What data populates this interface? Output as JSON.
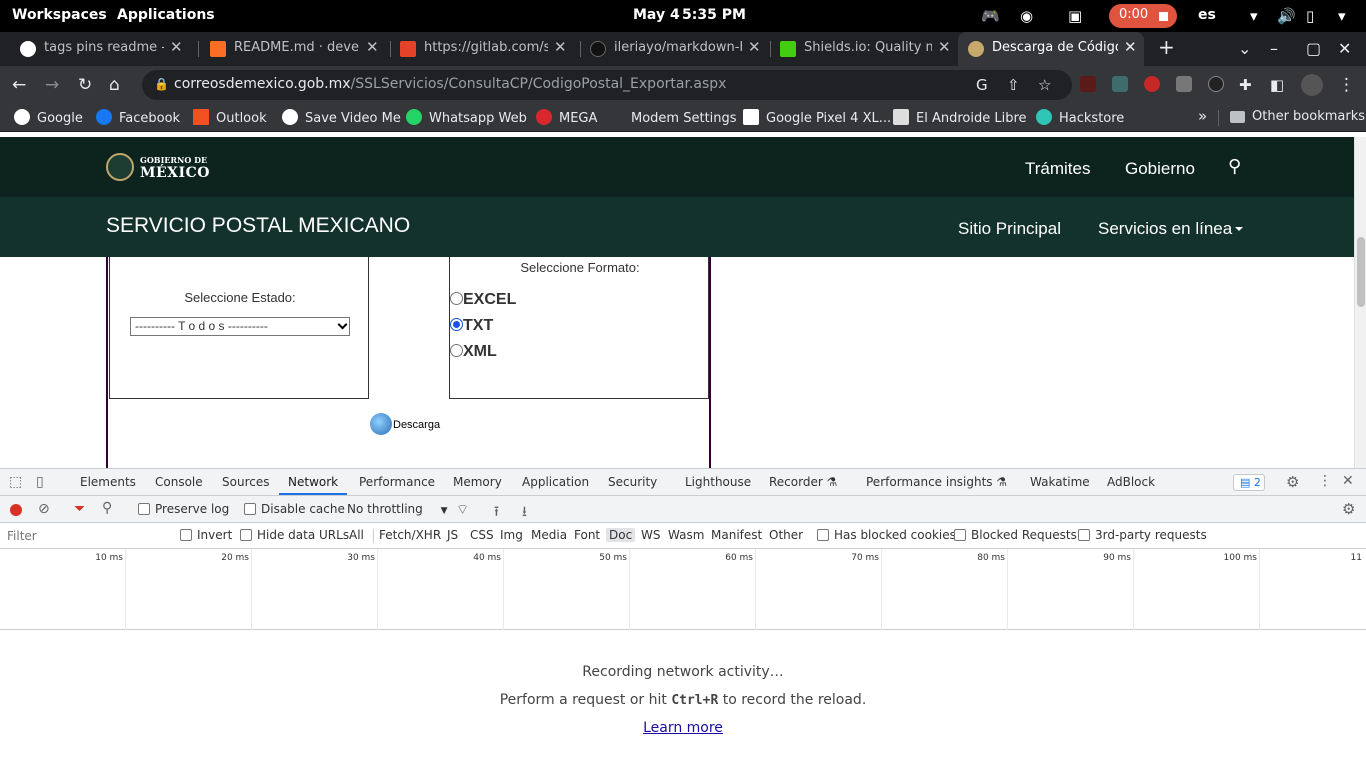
{
  "system": {
    "workspaces": "Workspaces",
    "applications": "Applications",
    "date": "May 4",
    "time": "5:35 PM",
    "recording_time": "0:00",
    "language": "es"
  },
  "browser": {
    "tabs": [
      {
        "label": "tags pins readme - Go",
        "favicon": "google-icon",
        "color": "#ffffff"
      },
      {
        "label": "README.md · develop",
        "favicon": "gitlab-icon",
        "color": "#fc6d26"
      },
      {
        "label": "https://gitlab.com/s",
        "favicon": "gitlab-icon",
        "color": "#e24329"
      },
      {
        "label": "ileriayo/markdown-b",
        "favicon": "github-icon",
        "color": "#000000"
      },
      {
        "label": "Shields.io: Quality m",
        "favicon": "shields-icon",
        "color": "#4c1"
      },
      {
        "label": "Descarga de Códigos",
        "favicon": "correos-icon",
        "color": "#c7a96b"
      }
    ],
    "new_tab": "+",
    "url_host": "correosdemexico.gob.mx",
    "url_path": "/SSLServicios/ConsultaCP/CodigoPostal_Exportar.aspx",
    "bookmarks": [
      {
        "label": "Google",
        "color": "#4285f4"
      },
      {
        "label": "Facebook",
        "color": "#1877f2"
      },
      {
        "label": "Outlook",
        "color": "#f25022"
      },
      {
        "label": "Save Video Me",
        "color": "#ffffff"
      },
      {
        "label": "Whatsapp Web",
        "color": "#25d366"
      },
      {
        "label": "MEGA",
        "color": "#d9272e"
      },
      {
        "label": "Modem Settings",
        "color": "#35363a"
      },
      {
        "label": "Google Pixel 4 XL...",
        "color": "#ff9900"
      },
      {
        "label": "El Androide Libre",
        "color": "#dddddd"
      },
      {
        "label": "Hackstore",
        "color": "#2ec4b6"
      }
    ],
    "bookmarks_overflow": "»",
    "other_bookmarks": "Other bookmarks"
  },
  "page": {
    "gob_line1": "GOBIERNO DE",
    "gob_line2": "MÉXICO",
    "gob_links": [
      "Trámites",
      "Gobierno"
    ],
    "sepomex_title": "SERVICIO POSTAL MEXICANO",
    "sepomex_links": [
      "Sitio Principal",
      "Servicios en línea"
    ],
    "estado_label": "Seleccione Estado:",
    "estado_value": "---------- T o d o s ----------",
    "formato_label": "Seleccione Formato:",
    "formatos": [
      {
        "label": "EXCEL",
        "checked": false
      },
      {
        "label": "TXT",
        "checked": true
      },
      {
        "label": "XML",
        "checked": false
      }
    ],
    "descarga": "Descarga"
  },
  "devtools": {
    "tabs": [
      "Elements",
      "Console",
      "Sources",
      "Network",
      "Performance",
      "Memory",
      "Application",
      "Security",
      "Lighthouse",
      "Recorder",
      "Performance insights",
      "Wakatime",
      "AdBlock"
    ],
    "active_tab": "Network",
    "issues_count": "2",
    "preserve_log": "Preserve log",
    "disable_cache": "Disable cache",
    "throttling": "No throttling",
    "filter_placeholder": "Filter",
    "invert": "Invert",
    "hide_data_urls": "Hide data URLs",
    "type_filters": [
      "All",
      "Fetch/XHR",
      "JS",
      "CSS",
      "Img",
      "Media",
      "Font",
      "Doc",
      "WS",
      "Wasm",
      "Manifest",
      "Other"
    ],
    "selected_type_filter": "Doc",
    "has_blocked_cookies": "Has blocked cookies",
    "blocked_requests": "Blocked Requests",
    "third_party": "3rd-party requests",
    "timeline_ticks": [
      "10 ms",
      "20 ms",
      "30 ms",
      "40 ms",
      "50 ms",
      "60 ms",
      "70 ms",
      "80 ms",
      "90 ms",
      "100 ms",
      "11"
    ],
    "empty_line1": "Recording network activity…",
    "empty_line2_pre": "Perform a request or hit ",
    "empty_shortcut": "Ctrl+R",
    "empty_line2_post": " to record the reload.",
    "learn_more": "Learn more"
  }
}
